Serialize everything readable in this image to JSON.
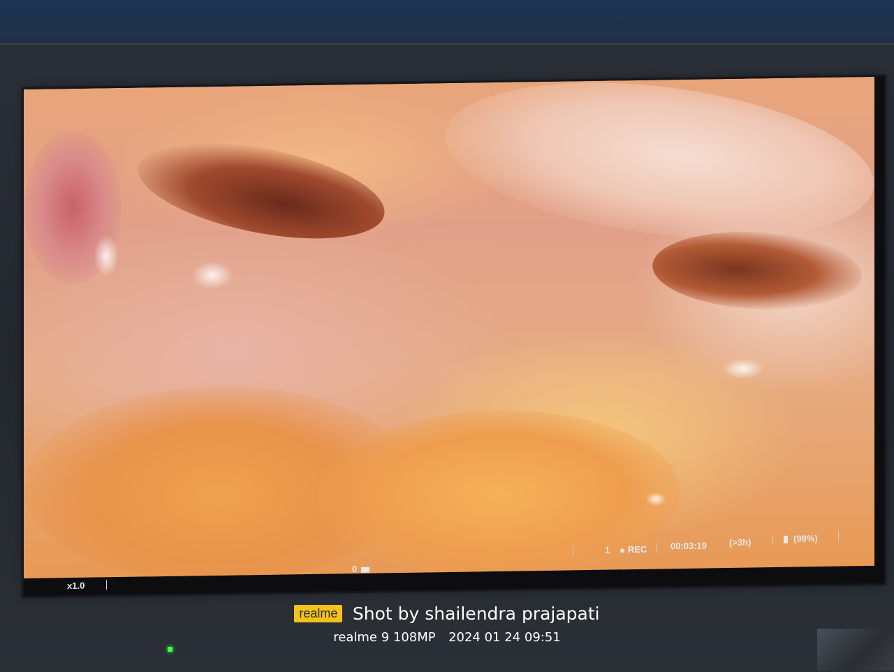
{
  "monitor": {
    "osd": {
      "zoom": "x1.0",
      "card_count": "0",
      "channel": "1",
      "rec_label": "REC",
      "elapsed_time": "00:03:19",
      "remaining_time": "(>3h)",
      "battery": "(98%)"
    },
    "power_led_color": "#3cff4e"
  },
  "watermark": {
    "brand": "realme",
    "credit": "Shot by shailendra prajapati",
    "device": "realme 9 108MP",
    "datetime": "2024 01 24 09:51"
  }
}
